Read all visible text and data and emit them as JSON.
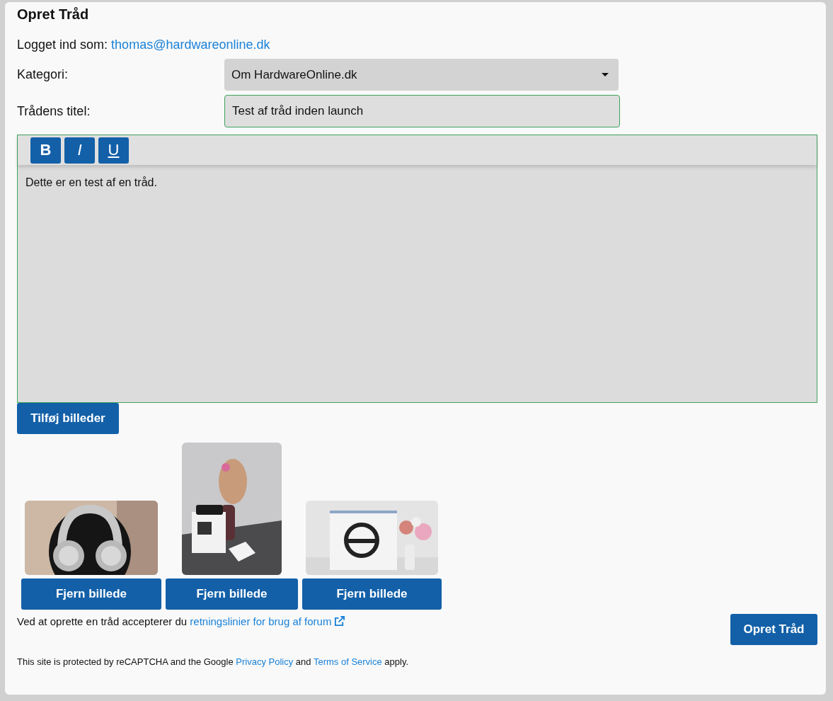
{
  "heading": "Opret Tråd",
  "logged_in": {
    "label": "Logget ind som:",
    "email": "thomas@hardwareonline.dk"
  },
  "category": {
    "label": "Kategori:",
    "value": "Om HardwareOnline.dk"
  },
  "thread_title": {
    "label": "Trådens titel:",
    "value": "Test af tråd inden launch"
  },
  "editor": {
    "toolbar": [
      {
        "label": "B",
        "kind": "bold"
      },
      {
        "label": "I",
        "kind": "italic"
      },
      {
        "label": "U",
        "kind": "underline"
      }
    ],
    "body": "Dette er en test af en tråd."
  },
  "add_images_button": "Tilføj billeder",
  "images": [
    {
      "kind": "picture",
      "remove_button": "Fjern billede"
    },
    {
      "kind": "picture",
      "remove_button": "Fjern billede"
    },
    {
      "kind": "picture",
      "remove_button": "Fjern billede"
    }
  ],
  "terms": {
    "text": "Ved at oprette en tråd accepterer du",
    "link": "retningslinier for brug af forum"
  },
  "submit_button": "Opret Tråd",
  "recaptcha": {
    "text_1": "This site is protected by reCAPTCHA and the Google",
    "link_1": "Privacy Policy",
    "text_2": "and",
    "link_2": "Terms of Service",
    "text_3": "apply."
  }
}
